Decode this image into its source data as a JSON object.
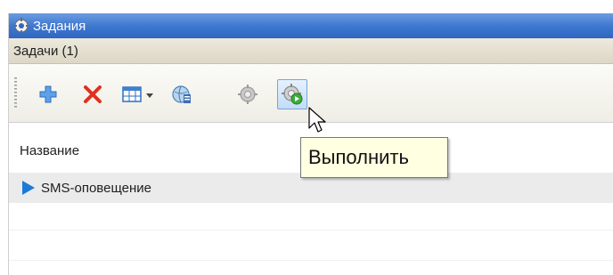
{
  "window": {
    "title": "Задания",
    "icon": "gear-tasks-icon"
  },
  "section": {
    "title": "Задачи (1)"
  },
  "toolbar": {
    "buttons": [
      {
        "name": "add-button",
        "icon": "plus-icon"
      },
      {
        "name": "delete-button",
        "icon": "red-x-icon"
      },
      {
        "name": "view-dropdown-button",
        "icon": "grid-icon"
      },
      {
        "name": "edit-button",
        "icon": "globe-edit-icon"
      },
      {
        "name": "settings-button",
        "icon": "gear-disabled-icon"
      },
      {
        "name": "run-button",
        "icon": "gear-run-icon"
      }
    ]
  },
  "table": {
    "column_header": "Название",
    "rows": [
      {
        "label": "SMS-оповещение",
        "selected": true
      }
    ]
  },
  "tooltip": {
    "text": "Выполнить"
  },
  "colors": {
    "titlebar": "#3f78d0",
    "selection": "#ebebeb",
    "tooltip_bg": "#ffffe1",
    "accent": "#1c7ad6"
  }
}
